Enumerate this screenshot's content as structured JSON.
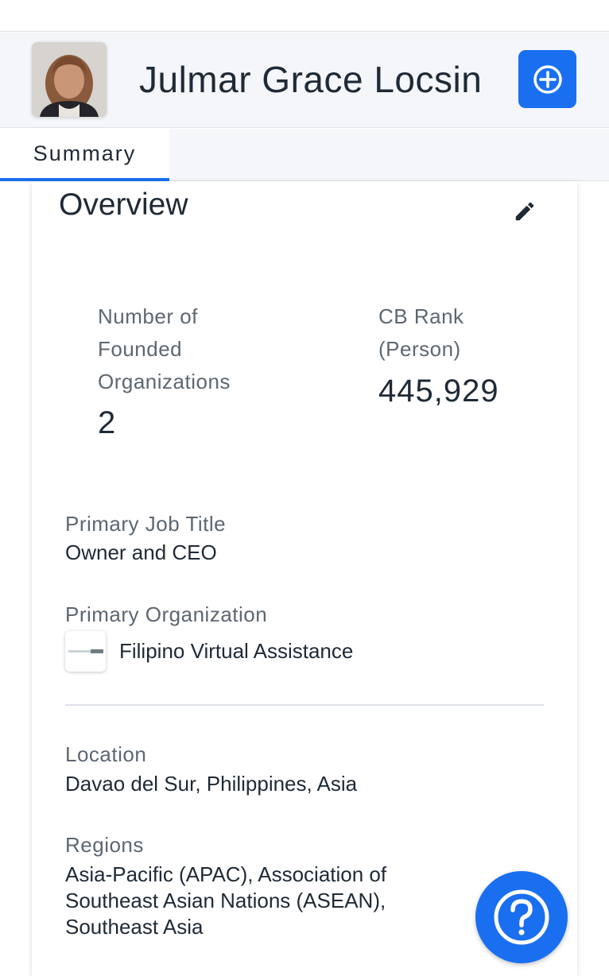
{
  "profile": {
    "name": "Julmar Grace Locsin"
  },
  "tabs": [
    {
      "label": "Summary",
      "active": true
    }
  ],
  "overview": {
    "title": "Overview",
    "stats": [
      {
        "label_lines": [
          "Number of",
          "Founded",
          "Organizations"
        ],
        "value": "2"
      },
      {
        "label_lines": [
          "CB Rank",
          "(Person)"
        ],
        "value": "445,929"
      }
    ],
    "primary_job_title": {
      "label": "Primary Job Title",
      "value": "Owner and CEO"
    },
    "primary_organization": {
      "label": "Primary Organization",
      "value": "Filipino Virtual Assistance"
    },
    "location": {
      "label": "Location",
      "value": "Davao del Sur, Philippines, Asia"
    },
    "regions": {
      "label": "Regions",
      "value_lines": [
        "Asia-Pacific (APAC), Association of",
        "Southeast Asian Nations (ASEAN),",
        "Southeast Asia"
      ]
    }
  },
  "icons": {
    "add": "plus-circle-icon",
    "edit": "pencil-icon",
    "help": "question-circle-icon"
  },
  "colors": {
    "accent": "#1a6ff0",
    "text_primary": "#1f2a36",
    "text_secondary": "#5d6772"
  }
}
